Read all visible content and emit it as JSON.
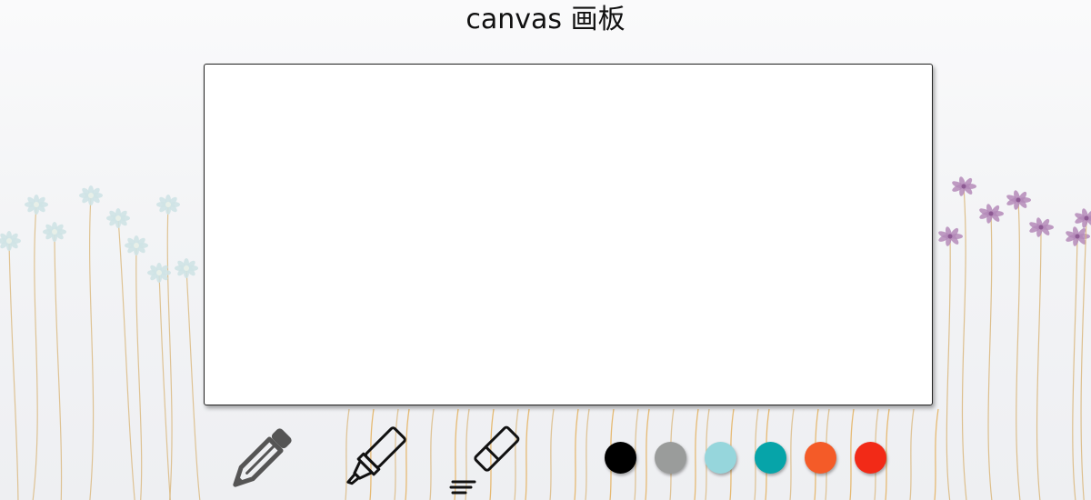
{
  "page": {
    "title": "canvas 画板"
  },
  "tools": [
    {
      "name": "pencil",
      "icon": "pencil-icon",
      "color": "#555555"
    },
    {
      "name": "pen",
      "icon": "marker-pen-icon",
      "color": "#111111"
    },
    {
      "name": "eraser",
      "icon": "eraser-icon",
      "color": "#111111"
    }
  ],
  "palette": [
    {
      "name": "black",
      "color": "#000000"
    },
    {
      "name": "gray",
      "color": "#9a9c9b"
    },
    {
      "name": "light-cyan",
      "color": "#96d6dc"
    },
    {
      "name": "teal",
      "color": "#06a4a9"
    },
    {
      "name": "orange",
      "color": "#f45b28"
    },
    {
      "name": "red",
      "color": "#f22a17"
    }
  ],
  "background": {
    "decor": "wildflowers",
    "left_flower_color": "#cfe3e5",
    "right_flower_color": "#b48ab8",
    "stem_color": "#d9b67a"
  }
}
